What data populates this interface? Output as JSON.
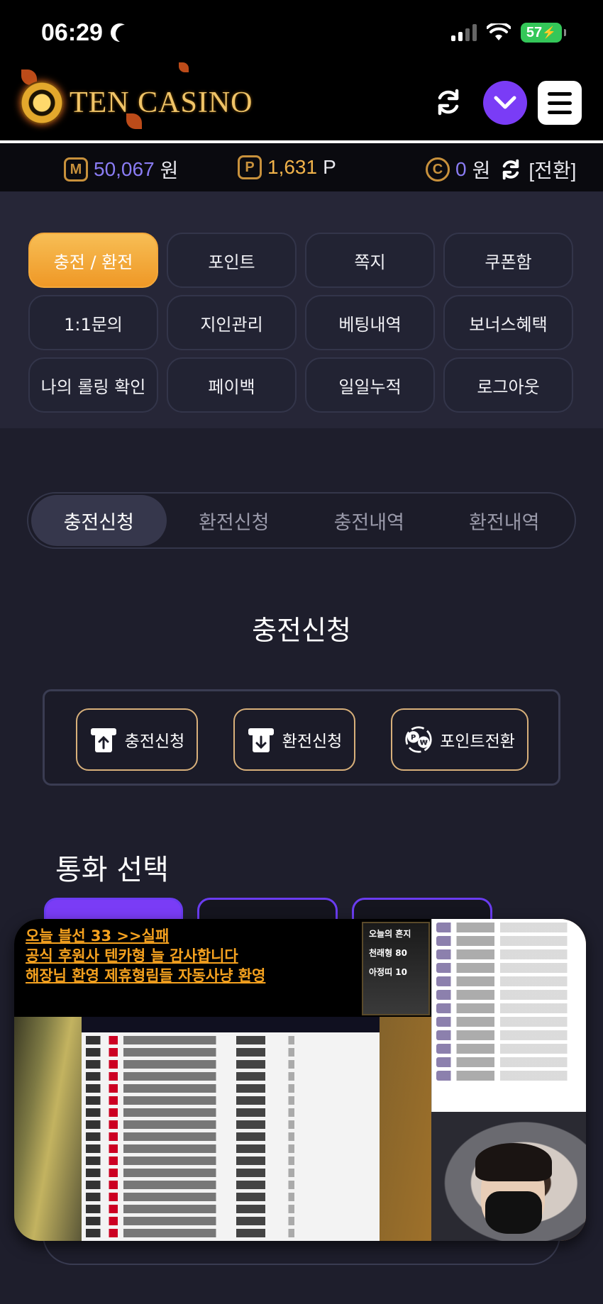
{
  "status_bar": {
    "time": "06:29",
    "battery": "57"
  },
  "header": {
    "logo_text": "TEN CASINO"
  },
  "balances": {
    "money": {
      "icon": "M",
      "value": "50,067",
      "unit": "원",
      "color": "#8a7cf4"
    },
    "point": {
      "icon": "P",
      "value": "1,631",
      "unit": "P",
      "color": "#f0b24a"
    },
    "coin": {
      "icon": "C",
      "value": "0",
      "unit": "원",
      "color": "#8a7cf4"
    },
    "convert_label": "[전환]"
  },
  "menu": [
    "충전 / 환전",
    "포인트",
    "쪽지",
    "쿠폰함",
    "1:1문의",
    "지인관리",
    "베팅내역",
    "보너스혜택",
    "나의 롤링 확인",
    "페이백",
    "일일누적",
    "로그아웃"
  ],
  "tabs": [
    "충전신청",
    "환전신청",
    "충전내역",
    "환전내역"
  ],
  "page_title": "충전신청",
  "actions": {
    "deposit": "충전신청",
    "withdraw": "환전신청",
    "point_convert": "포인트전환"
  },
  "currency_title": "통화 선택",
  "stream": {
    "ticker": [
      "오늘 블선 33 >>실패",
      "공식 후원사 텐카형 늘 감사합니다",
      "해장님 환영 제휴형림들 자동사냥 환영"
    ],
    "today_title": "오늘의 흔지",
    "today_line1": "천래형 80",
    "today_line2": "아정띠 10"
  },
  "colors": {
    "accent": "#7a3cf6",
    "gold": "#f3a83a"
  }
}
